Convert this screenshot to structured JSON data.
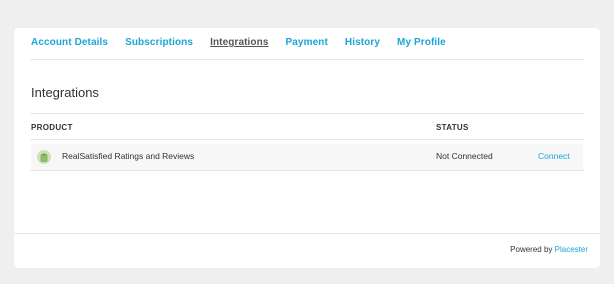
{
  "nav": {
    "tabs": [
      {
        "label": "Account Details",
        "active": false
      },
      {
        "label": "Subscriptions",
        "active": false
      },
      {
        "label": "Integrations",
        "active": true
      },
      {
        "label": "Payment",
        "active": false
      },
      {
        "label": "History",
        "active": false
      },
      {
        "label": "My Profile",
        "active": false
      }
    ]
  },
  "page": {
    "title": "Integrations"
  },
  "table": {
    "headers": {
      "product": "PRODUCT",
      "status": "STATUS"
    },
    "rows": [
      {
        "icon": "clipboard-icon",
        "product": "RealSatisfied Ratings and Reviews",
        "status": "Not Connected",
        "action": "Connect"
      }
    ]
  },
  "footer": {
    "powered_by": "Powered by",
    "brand": "Placester"
  },
  "colors": {
    "accent": "#1ca6d6",
    "background": "#efefef",
    "row_bg": "#f7f7f7",
    "icon_bg": "#cfe0bf"
  }
}
